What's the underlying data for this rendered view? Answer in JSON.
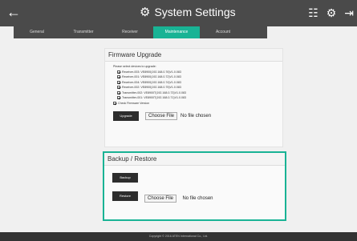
{
  "header": {
    "title": "System Settings",
    "back_icon": "arrow-left-icon",
    "title_icon": "gear-icon",
    "right_icons": [
      "calendar-icon",
      "gear-icon",
      "logout-icon"
    ]
  },
  "tabs": [
    {
      "label": "General",
      "active": false
    },
    {
      "label": "Transmitter",
      "active": false
    },
    {
      "label": "Receiver",
      "active": false
    },
    {
      "label": "Maintenance",
      "active": true
    },
    {
      "label": "Account",
      "active": false
    }
  ],
  "firmware": {
    "title": "Firmware Upgrade",
    "hint": "Please select devices to upgrade:",
    "devices": [
      "Receiver-003: VE8900(192.168.0.76)V1.0.083",
      "Receiver-001: VE8900(192.168.0.72)V1.0.083",
      "Receiver-004: VE8900(192.168.0.74)V1.0.083",
      "Receiver-002: VE8900(192.168.0.75)V1.0.083",
      "Transmitter-002: VE8900T(192.168.0.73)V1.0.083",
      "Transmitter-001: VE8900T(192.168.0.71)V1.0.083"
    ],
    "check_label": "Check Firmware Version",
    "upgrade_label": "Upgrade",
    "choose_label": "Choose File",
    "no_file": "No file chosen"
  },
  "backup": {
    "title": "Backup / Restore",
    "backup_label": "Backup",
    "restore_label": "Restore",
    "choose_label": "Choose File",
    "no_file": "No file chosen"
  },
  "footer": {
    "text": "Copyright © 2016 ATEN International Co., Ltd."
  },
  "colors": {
    "accent": "#19b395",
    "bar": "#4a4a4a"
  }
}
